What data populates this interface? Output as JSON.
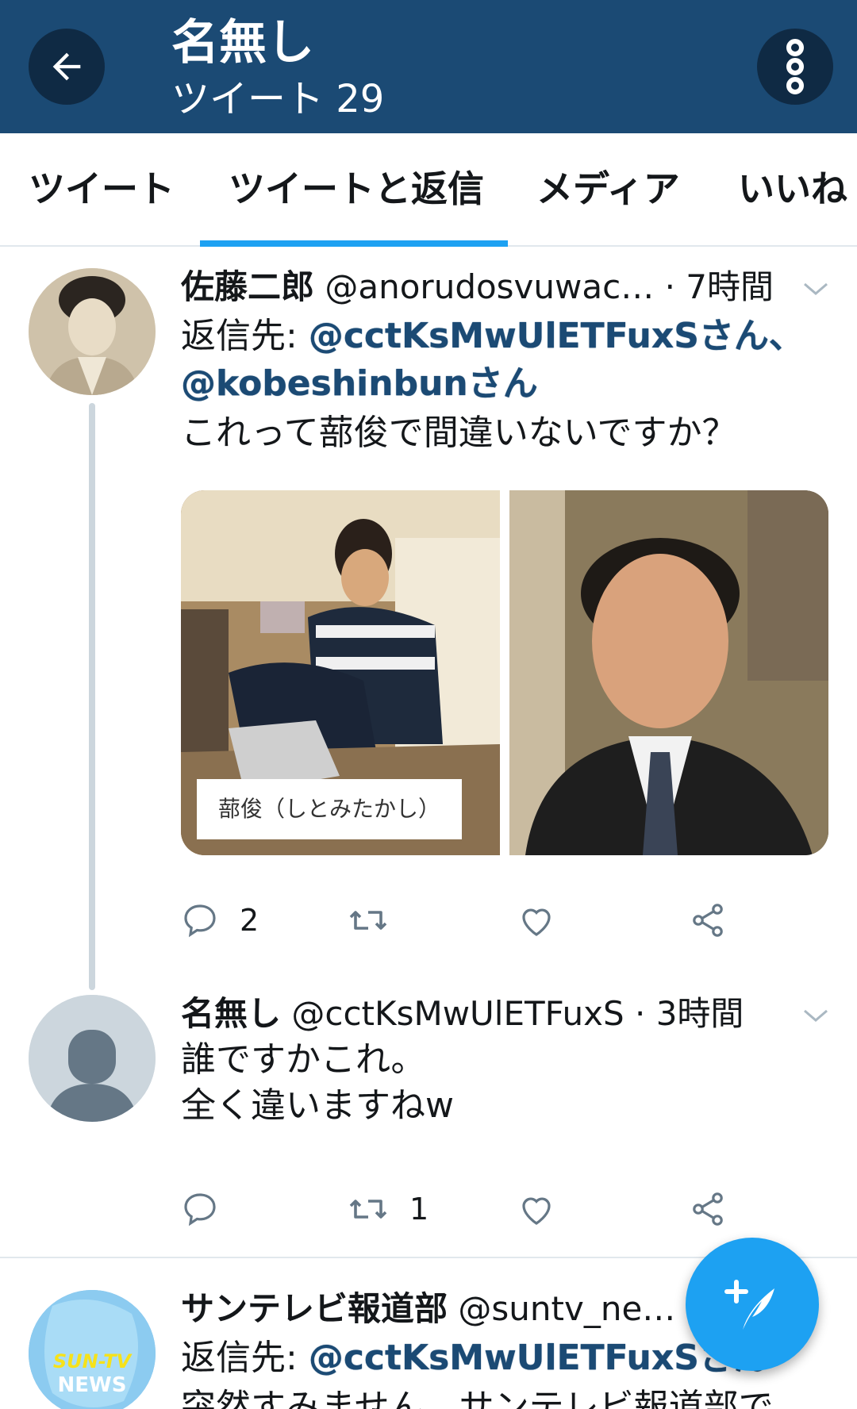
{
  "header": {
    "title": "名無し",
    "subtitle": "ツイート 29",
    "back_icon": "arrow-left-icon",
    "more_icon": "more-vertical-icon",
    "background": "#1b4a74"
  },
  "tabs": [
    {
      "label": "ツイート"
    },
    {
      "label": "ツイートと返信",
      "selected": true
    },
    {
      "label": "メディア"
    },
    {
      "label": "いいね"
    }
  ],
  "accent_color": "#1da1f2",
  "tweets": [
    {
      "name": "佐藤二郎",
      "handle": "@anorudosvuwac…",
      "time": "· 7時間",
      "reply_prefix": "返信先:",
      "reply_mention_1": "@cctKsMwUlETFuxSさん、",
      "reply_mention_2": "@kobeshinbunさん",
      "text": "これって蔀俊で間違いないですか？",
      "image_caption": "蔀俊（しとみたかし）",
      "reply_count": "2",
      "retweet_count": "",
      "like_count": ""
    },
    {
      "name": "名無し",
      "handle": "@cctKsMwUlETFuxS",
      "time": "· 3時間",
      "text_line_1": "誰ですかこれ。",
      "text_line_2": "全く違いますねw",
      "reply_count": "",
      "retweet_count": "1",
      "like_count": ""
    },
    {
      "name": "サンテレビ報道部",
      "handle": "@suntv_ne…",
      "reply_prefix": "返信先:",
      "reply_mention_1": "@cctKsMwUlETFuxSさん",
      "text": "突然すみません。サンテレビ報道部で",
      "avatar_logo_line_1": "SUN-TV",
      "avatar_logo_line_2": "NEWS"
    }
  ],
  "fab": {
    "icon": "compose-feather-icon"
  }
}
